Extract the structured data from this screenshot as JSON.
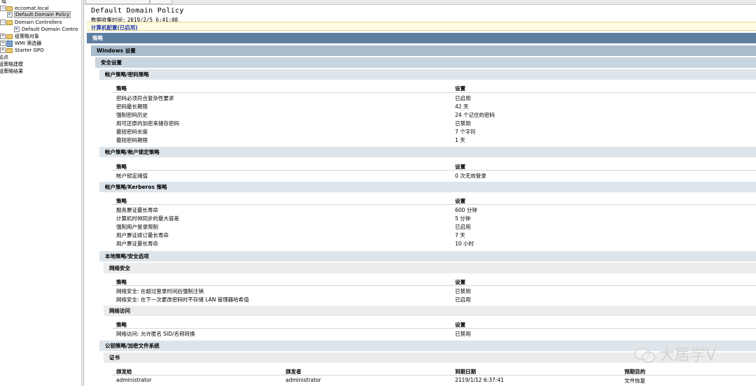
{
  "tree": {
    "top_partial": "域",
    "domain": "eccomat.local",
    "default_domain_policy": "Default Domain Policy",
    "domain_controllers": "Domain Controllers",
    "default_domain_controllers": "Default Domain Contro",
    "gpo_objects": "组策略对象",
    "wmi_filters": "WMI 筛选器",
    "starter_gpo": "Starter GPO",
    "sites": "站点",
    "modeling": "组策略建模",
    "results": "组策略结果"
  },
  "report": {
    "title": "Default Domain Policy",
    "date_label": "数据收集时间:",
    "date_value": "2019/2/5 6:41:08",
    "config": "计算机配置(已启用)",
    "bar_policy": "策略",
    "bar_windows": "Windows 设置",
    "bar_security": "安全设置",
    "col_policy": "策略",
    "col_setting": "设置",
    "sections": {
      "password": {
        "title": "帐户策略/密码策略",
        "rows": [
          {
            "policy": "密码必须符合复杂性要求",
            "setting": "已启用"
          },
          {
            "policy": "密码最长期限",
            "setting": "42 天"
          },
          {
            "policy": "强制密码历史",
            "setting": "24 个记住的密码"
          },
          {
            "policy": "用可还原的加密来储存密码",
            "setting": "已禁用"
          },
          {
            "policy": "最短密码长度",
            "setting": "7 个字符"
          },
          {
            "policy": "最短密码期限",
            "setting": "1 天"
          }
        ]
      },
      "lockout": {
        "title": "帐户策略/帐户锁定策略",
        "rows": [
          {
            "policy": "帐户锁定阈值",
            "setting": "0 次无效登录"
          }
        ]
      },
      "kerberos": {
        "title": "帐户策略/Kerberos 策略",
        "rows": [
          {
            "policy": "服务票证最长寿命",
            "setting": "600 分钟"
          },
          {
            "policy": "计算机时钟同步的最大容差",
            "setting": "5 分钟"
          },
          {
            "policy": "强制用户登录限制",
            "setting": "已启用"
          },
          {
            "policy": "用户票证续订最长寿命",
            "setting": "7 天"
          },
          {
            "policy": "用户票证最长寿命",
            "setting": "10 小时"
          }
        ]
      },
      "local": {
        "title": "本地策略/安全选项",
        "netsec_title": "网络安全",
        "netsec_rows": [
          {
            "policy": "网络安全: 在超过登录时间后强制注销",
            "setting": "已禁用"
          },
          {
            "policy": "网络安全: 在下一次更改密码时不存储 LAN 管理器哈希值",
            "setting": "已启用"
          }
        ],
        "netacc_title": "网络访问",
        "netacc_rows": [
          {
            "policy": "网络访问: 允许匿名 SID/名称转换",
            "setting": "已禁用"
          }
        ]
      },
      "pk": {
        "title": "公钥策略/加密文件系统",
        "cert_title": "证书",
        "cols": [
          "颁发给",
          "颁发者",
          "到期日期",
          "预期目的"
        ],
        "rows": [
          {
            "issued_to": "administrator",
            "issuer": "administrator",
            "expires": "2119/1/12 6:37:41",
            "purpose": "文件恢复"
          }
        ]
      }
    }
  },
  "watermark": {
    "icon": "wechat-icon",
    "text": "大居学V"
  }
}
